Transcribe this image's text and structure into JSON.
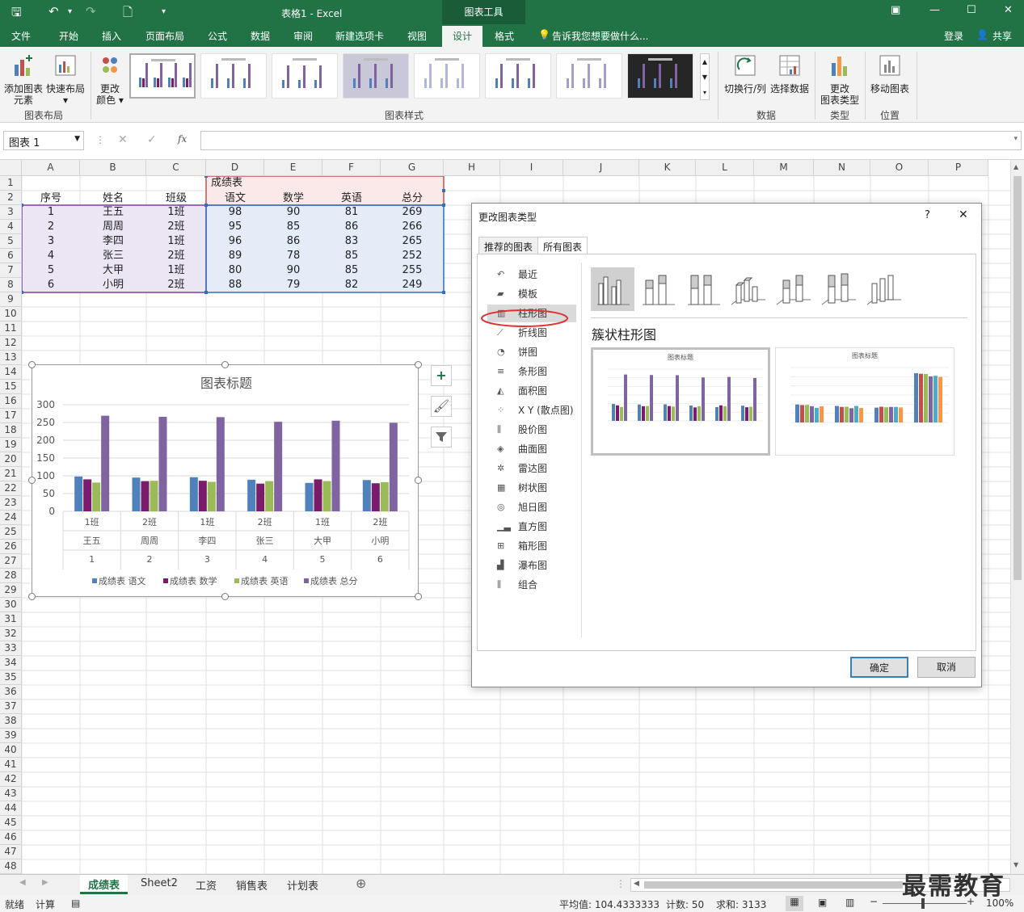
{
  "titlebar": {
    "doc_title": "表格1 - Excel",
    "tool_tab": "图表工具"
  },
  "ribbon_tabs": [
    "文件",
    "开始",
    "插入",
    "页面布局",
    "公式",
    "数据",
    "审阅",
    "新建选项卡",
    "视图",
    "设计",
    "格式"
  ],
  "ribbon_active_tab": "设计",
  "tell_me": "告诉我您想要做什么...",
  "login": "登录",
  "share": "共享",
  "ribbon": {
    "add_element_1": "添加图表",
    "add_element_2": "元素",
    "quick_layout": "快速布局",
    "change_color_1": "更改",
    "change_color_2": "颜色",
    "switch_row_col": "切换行/列",
    "select_data": "选择数据",
    "change_type_1": "更改",
    "change_type_2": "图表类型",
    "move_chart": "移动图表",
    "groups": {
      "layout": "图表布局",
      "styles": "图表样式",
      "data": "数据",
      "type": "类型",
      "location": "位置"
    }
  },
  "formula_bar": {
    "name_box": "图表 1",
    "fx": "fx"
  },
  "columns": [
    "A",
    "B",
    "C",
    "D",
    "E",
    "F",
    "G",
    "H",
    "I",
    "J",
    "K",
    "L",
    "M",
    "N",
    "O",
    "P"
  ],
  "rows": [
    "1",
    "2",
    "3",
    "4",
    "5",
    "6",
    "7",
    "8",
    "9",
    "10",
    "11",
    "12",
    "13",
    "14",
    "15",
    "16",
    "17",
    "18",
    "19",
    "20",
    "21",
    "22",
    "23",
    "24",
    "25",
    "26",
    "27",
    "28",
    "29",
    "30",
    "31",
    "32",
    "33",
    "34",
    "35",
    "36",
    "37",
    "38",
    "39",
    "40",
    "41",
    "42",
    "43",
    "44",
    "45",
    "46",
    "47",
    "48"
  ],
  "table": {
    "group_header": "成绩表",
    "headers": [
      "序号",
      "姓名",
      "班级",
      "语文",
      "数学",
      "英语",
      "总分"
    ],
    "rows": [
      [
        "1",
        "王五",
        "1班",
        "98",
        "90",
        "81",
        "269"
      ],
      [
        "2",
        "周周",
        "2班",
        "95",
        "85",
        "86",
        "266"
      ],
      [
        "3",
        "李四",
        "1班",
        "96",
        "86",
        "83",
        "265"
      ],
      [
        "4",
        "张三",
        "2班",
        "89",
        "78",
        "85",
        "252"
      ],
      [
        "5",
        "大甲",
        "1班",
        "80",
        "90",
        "85",
        "255"
      ],
      [
        "6",
        "小明",
        "2班",
        "88",
        "79",
        "82",
        "249"
      ]
    ]
  },
  "chart_data": {
    "type": "bar",
    "title": "图表标题",
    "ylim": [
      0,
      300
    ],
    "yticks": [
      "0",
      "50",
      "100",
      "150",
      "200",
      "250",
      "300"
    ],
    "categories": [
      [
        "1班",
        "王五",
        "1"
      ],
      [
        "2班",
        "周周",
        "2"
      ],
      [
        "1班",
        "李四",
        "3"
      ],
      [
        "2班",
        "张三",
        "4"
      ],
      [
        "1班",
        "大甲",
        "5"
      ],
      [
        "2班",
        "小明",
        "6"
      ]
    ],
    "series": [
      {
        "name": "成绩表 语文",
        "color": "#4f81bd",
        "values": [
          98,
          95,
          96,
          89,
          80,
          88
        ]
      },
      {
        "name": "成绩表 数学",
        "color": "#7b1b6b",
        "values": [
          90,
          85,
          86,
          78,
          90,
          79
        ]
      },
      {
        "name": "成绩表 英语",
        "color": "#9bbb59",
        "values": [
          81,
          86,
          83,
          85,
          85,
          82
        ]
      },
      {
        "name": "成绩表 总分",
        "color": "#8064a2",
        "values": [
          269,
          266,
          265,
          252,
          255,
          249
        ]
      }
    ],
    "legend": "bottom",
    "grid": true
  },
  "dialog": {
    "title": "更改图表类型",
    "help": "?",
    "close": "✕",
    "tabs": [
      "推荐的图表",
      "所有图表"
    ],
    "active_tab": "所有图表",
    "types": [
      "最近",
      "模板",
      "柱形图",
      "折线图",
      "饼图",
      "条形图",
      "面积图",
      "X Y (散点图)",
      "股价图",
      "曲面图",
      "雷达图",
      "树状图",
      "旭日图",
      "直方图",
      "箱形图",
      "瀑布图",
      "组合"
    ],
    "selected_type": "柱形图",
    "subtype_title": "簇状柱形图",
    "preview_title_1": "图表标题",
    "preview_title_2": "图表标题",
    "ok": "确定",
    "cancel": "取消"
  },
  "sheet_tabs": [
    "成绩表",
    "Sheet2",
    "工资",
    "销售表",
    "计划表"
  ],
  "active_sheet": "成绩表",
  "status": {
    "ready": "就绪",
    "calc": "计算",
    "average": "平均值: 104.4333333",
    "count": "计数: 50",
    "sum": "求和: 3133",
    "zoom": "100%"
  },
  "watermark": "最需教育"
}
